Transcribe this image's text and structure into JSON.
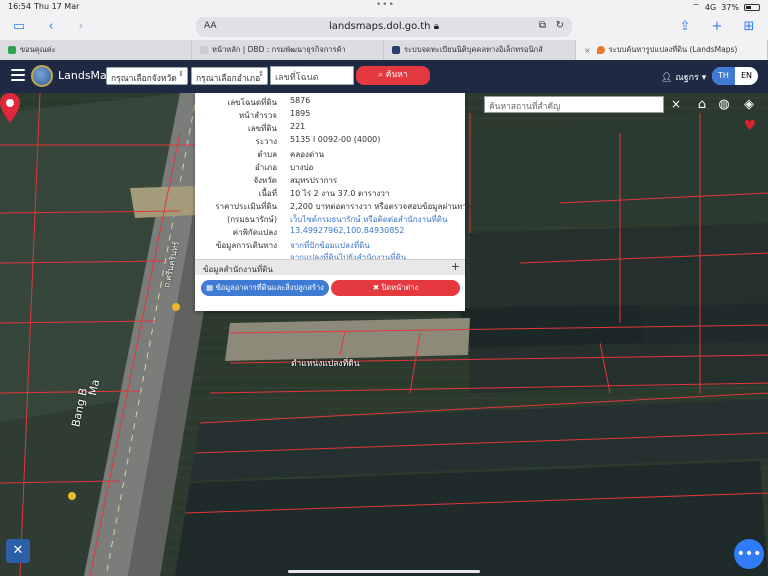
{
  "status": {
    "time": "16:54",
    "date": "Thu 17 Mar",
    "network": "4G",
    "battery": "37%"
  },
  "browser": {
    "aa_label": "AA",
    "url": "landsmaps.dol.go.th",
    "tabs": [
      {
        "label": "ขอนคุณค่ะ",
        "color": "#2fa44f"
      },
      {
        "label": "หน้าหลัก | DBD : กรมพัฒนาธุรกิจการค้า",
        "color": "#c9ccd2"
      },
      {
        "label": "ระบบจดทะเบียนนิติบุคคลทางอิเล็กทรอนิกส์",
        "color": "#2b3b6e"
      },
      {
        "label": "ระบบค้นหารูปแปลงที่ดิน (LandsMaps)",
        "color": "#e87a2a"
      }
    ]
  },
  "app": {
    "name": "LandsMaps",
    "province_select": "กรุณาเลือกจังหวัด",
    "amphoe_select": "กรุณาเลือกอำเภอ",
    "deed_placeholder": "เลขที่โฉนด",
    "search_button": "ค้นหา",
    "user": "ณฐกร",
    "lang_th": "TH",
    "lang_en": "EN"
  },
  "map": {
    "place_search_placeholder": "ค้นหาสถานที่สำคัญ",
    "close": "×",
    "pin_label": "ตำแหน่งแปลงที่ดิน",
    "road_labels": [
      "ถ.ศรีนครินทร์",
      "Bang B",
      "Ma"
    ]
  },
  "parcel": {
    "rows": [
      {
        "k": "เลขโฉนดที่ดิน",
        "v": "5876"
      },
      {
        "k": "หน้าสำรวจ",
        "v": "1895"
      },
      {
        "k": "เลขที่ดิน",
        "v": "221"
      },
      {
        "k": "ระวาง",
        "v": "5135 I 0092-00 (4000)"
      },
      {
        "k": "ตำบล",
        "v": "คลองด่าน"
      },
      {
        "k": "อำเภอ",
        "v": "บางบ่อ"
      },
      {
        "k": "จังหวัด",
        "v": "สมุทรปราการ"
      },
      {
        "k": "เนื้อที่",
        "v": "10 ไร่ 2 งาน 37.0 ตารางวา"
      },
      {
        "k": "ราคาประเมินที่ดิน",
        "v": "2,200 บาทต่อตารางวา หรือตรวจสอบข้อมูลผ่านทาง"
      },
      {
        "k": "(กรมธนารักษ์)",
        "v": "เว็บไซต์กรมธนารักษ์ หรือติดต่อสำนักงานที่ดิน",
        "link": true
      },
      {
        "k": "ค่าพิกัดแปลง",
        "v": "13.49927962,100.84930852",
        "link": true
      },
      {
        "k": "ข้อมูลการเดินทาง",
        "v": "จากที่ปักข้อมแปลงที่ดิน",
        "link": true
      },
      {
        "k": "",
        "v": "จากแปลงที่ดินไปยังสำนักงานที่ดิน",
        "link": true
      }
    ],
    "office_section": "ข้อมูลสำนักงานที่ดิน",
    "land_button": "ข้อมูลอาคารที่ดินและสิ่งปลูกสร้าง",
    "close_button": "ปิดหน้าต่าง"
  }
}
